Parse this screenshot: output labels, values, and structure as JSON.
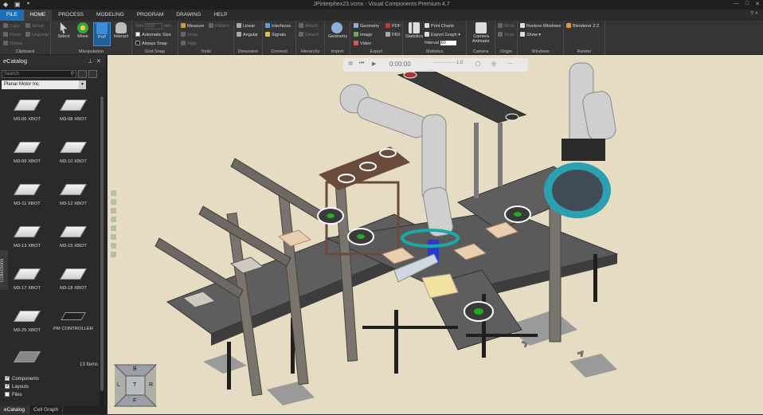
{
  "window": {
    "title": "JPinterphex23.vcmx - Visual Components Premium 4.7",
    "controls": [
      "—",
      "□",
      "✕"
    ]
  },
  "menu": {
    "tabs": [
      "FILE",
      "HOME",
      "PROCESS",
      "MODELING",
      "PROGRAM",
      "DRAWING",
      "HELP"
    ],
    "active": "HOME"
  },
  "ribbon": {
    "clipboard": {
      "label": "Clipboard",
      "copy": "Copy",
      "paste": "Paste",
      "delete": "Delete",
      "group": "Group",
      "ungroup": "Ungroup"
    },
    "manipulation": {
      "label": "Manipulation",
      "select": "Select",
      "move": "Move",
      "pnp": "PnP",
      "interact": "Interact"
    },
    "grid_snap": {
      "label": "Grid Snap",
      "size_label": "Size",
      "size_value": "100",
      "size_unit": "mm",
      "automatic_size": "Automatic Size",
      "always_snap": "Always Snap"
    },
    "tools": {
      "label": "Tools",
      "measure": "Measure",
      "pattern": "Pattern",
      "snap": "Snap",
      "align": "Align"
    },
    "dimension": {
      "label": "Dimension",
      "linear": "Linear",
      "angular": "Angular"
    },
    "connect": {
      "label": "Connect",
      "interfaces": "Interfaces",
      "signals": "Signals"
    },
    "hierarchy": {
      "label": "Hierarchy",
      "attach": "Attach",
      "detach": "Detach"
    },
    "import": {
      "label": "Import",
      "geometry": "Geometry"
    },
    "export": {
      "label": "Export",
      "geometry": "Geometry",
      "image": "Image",
      "video": "Video",
      "pdf": "PDF",
      "fbx": "FBX"
    },
    "statistics": {
      "label": "Statistics",
      "statistics": "Statistics",
      "print_charts": "Print Charts",
      "export_graph": "Export Graph ▾",
      "interval_label": "Interval",
      "interval_value": "60"
    },
    "camera": {
      "label": "Camera",
      "camera_animator": "Camera Animator"
    },
    "origin": {
      "label": "Origin",
      "move": "Move",
      "snap": "Snap"
    },
    "windows": {
      "label": "Windows",
      "restore_windows": "Restore Windows",
      "show": "Show ▾"
    },
    "render": {
      "label": "Render",
      "blenderer": "Blenderer 2.2"
    }
  },
  "ecatalog": {
    "title": "eCatalog",
    "search_placeholder": "Search",
    "manufacturer": "Planar Motor Inc",
    "items": [
      "M3-06 XBOT",
      "M3-08 XBOT",
      "M3-09 XBOT",
      "M3-10 XBOT",
      "M3-11 XBOT",
      "M3-12 XBOT",
      "M3-13 XBOT",
      "M3-15 XBOT",
      "M3-17 XBOT",
      "M3-18 XBOT",
      "M3-25 XBOT",
      "PM CONTROLLER",
      ""
    ],
    "count": "13 Items",
    "collections_tab": "Collections",
    "filters": [
      {
        "label": "Components",
        "checked": true
      },
      {
        "label": "Layouts",
        "checked": true
      },
      {
        "label": "Files",
        "checked": false
      }
    ],
    "bottom_tabs": [
      "eCatalog",
      "Cell Graph"
    ]
  },
  "player": {
    "time": "0:00:00",
    "speed": "1.0"
  },
  "navcube": {
    "top": "B",
    "left": "L",
    "center": "T",
    "right": "R",
    "bottom": "F"
  }
}
